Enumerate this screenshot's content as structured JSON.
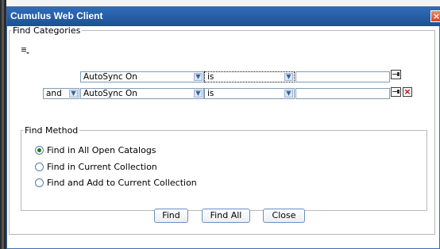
{
  "window": {
    "title": "Cumulus Web Client",
    "close_glyph": "×"
  },
  "find_categories": {
    "legend": "Find Categories",
    "rows": [
      {
        "conjunction": "",
        "field": "AutoSync On",
        "operator": "is",
        "value": ""
      },
      {
        "conjunction": "and",
        "field": "AutoSync On",
        "operator": "is",
        "value": ""
      }
    ],
    "remove_glyph": "×"
  },
  "find_method": {
    "legend": "Find Method",
    "options": [
      {
        "label": "Find in All Open Catalogs",
        "checked": true
      },
      {
        "label": "Find in Current Collection",
        "checked": false
      },
      {
        "label": "Find and Add to Current Collection",
        "checked": false
      }
    ]
  },
  "buttons": {
    "find": "Find",
    "find_all": "Find All",
    "close": "Close"
  }
}
